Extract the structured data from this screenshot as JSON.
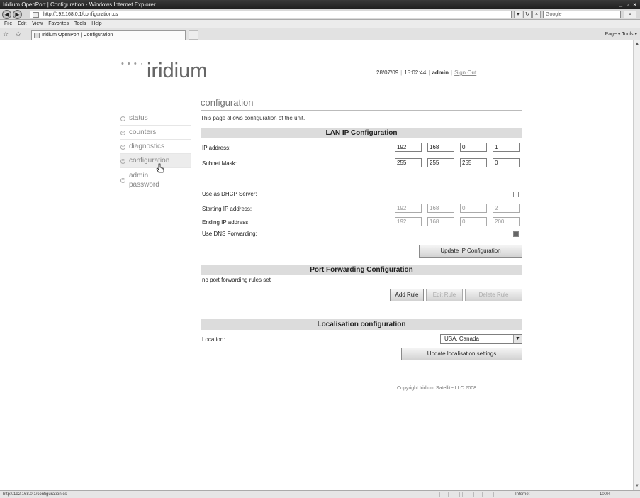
{
  "browser": {
    "title": "Iridium OpenPort | Configuration - Windows Internet Explorer",
    "url": "http://192.168.0.1/configuration.cs",
    "search_placeholder": "Google",
    "menu": [
      "File",
      "Edit",
      "View",
      "Favorites",
      "Tools",
      "Help"
    ],
    "tab_label": "Iridium OpenPort | Configuration",
    "command_bar": "Page ▾  Tools ▾",
    "status_url": "http://192.168.0.1/configuration.cs",
    "status_zone": "Internet",
    "status_zoom": "100%"
  },
  "header": {
    "logo_text": "iridium",
    "logo_dots": "• • • ·",
    "date": "28/07/09",
    "time": "15:02:44",
    "user": "admin",
    "signout": "Sign Out"
  },
  "page_title": "configuration",
  "description": "This page allows configuration of the unit.",
  "nav": [
    {
      "label": "status"
    },
    {
      "label": "counters"
    },
    {
      "label": "diagnostics"
    },
    {
      "label": "configuration"
    },
    {
      "label": "admin password"
    }
  ],
  "lan": {
    "heading": "LAN IP Configuration",
    "ip_label": "IP address:",
    "ip": [
      "192",
      "168",
      "0",
      "1"
    ],
    "mask_label": "Subnet Mask:",
    "mask": [
      "255",
      "255",
      "255",
      "0"
    ],
    "dhcp_label": "Use as DHCP Server:",
    "dhcp_checked": false,
    "start_label": "Starting IP address:",
    "start": [
      "192",
      "168",
      "0",
      "2"
    ],
    "end_label": "Ending IP address:",
    "end": [
      "192",
      "168",
      "0",
      "200"
    ],
    "dns_label": "Use DNS Forwarding:",
    "dns_checked": true,
    "update_button": "Update IP Configuration"
  },
  "port_forwarding": {
    "heading": "Port Forwarding Configuration",
    "empty_text": "no port forwarding rules set",
    "add_button": "Add Rule",
    "edit_button": "Edit Rule",
    "delete_button": "Delete Rule"
  },
  "localisation": {
    "heading": "Localisation configuration",
    "location_label": "Location:",
    "location_value": "USA, Canada",
    "update_button": "Update localisation settings"
  },
  "footer": {
    "copyright": "Copyright Iridium Satellite LLC 2008"
  }
}
